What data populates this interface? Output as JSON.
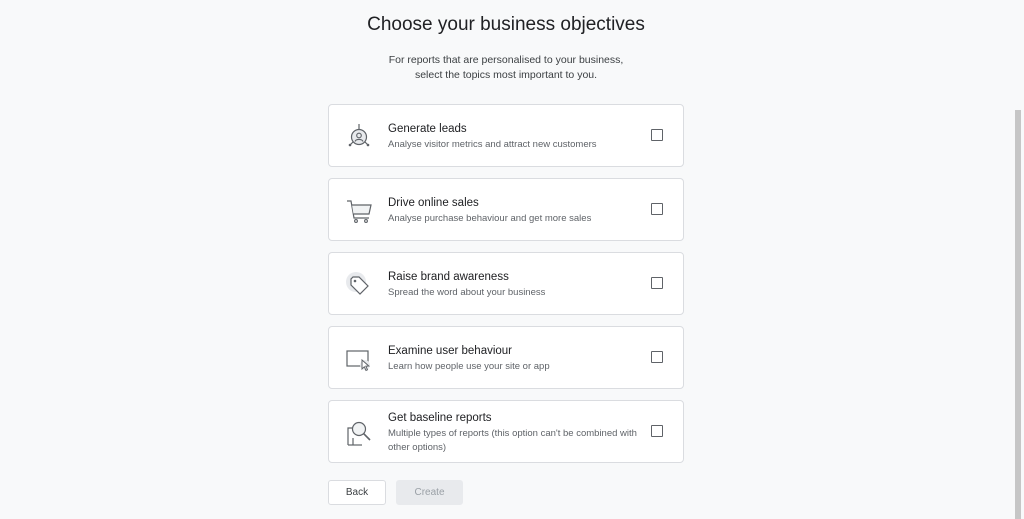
{
  "header": {
    "title": "Choose your business objectives",
    "subtitle_line1": "For reports that are personalised to your business,",
    "subtitle_line2": "select the topics most important to you."
  },
  "objectives": [
    {
      "title": "Generate leads",
      "description": "Analyse visitor metrics and attract new customers",
      "icon": "target-person-icon",
      "checked": false
    },
    {
      "title": "Drive online sales",
      "description": "Analyse purchase behaviour and get more sales",
      "icon": "shopping-cart-icon",
      "checked": false
    },
    {
      "title": "Raise brand awareness",
      "description": "Spread the word about your business",
      "icon": "price-tag-icon",
      "checked": false
    },
    {
      "title": "Examine user behaviour",
      "description": "Learn how people use your site or app",
      "icon": "screen-cursor-icon",
      "checked": false
    },
    {
      "title": "Get baseline reports",
      "description": "Multiple types of reports (this option can't be combined with other options)",
      "icon": "magnifier-report-icon",
      "checked": false
    }
  ],
  "buttons": {
    "back_label": "Back",
    "create_label": "Create"
  },
  "colors": {
    "background": "#f8f9fa",
    "card_border": "#dadce0",
    "disabled_button": "#e8eaed"
  }
}
